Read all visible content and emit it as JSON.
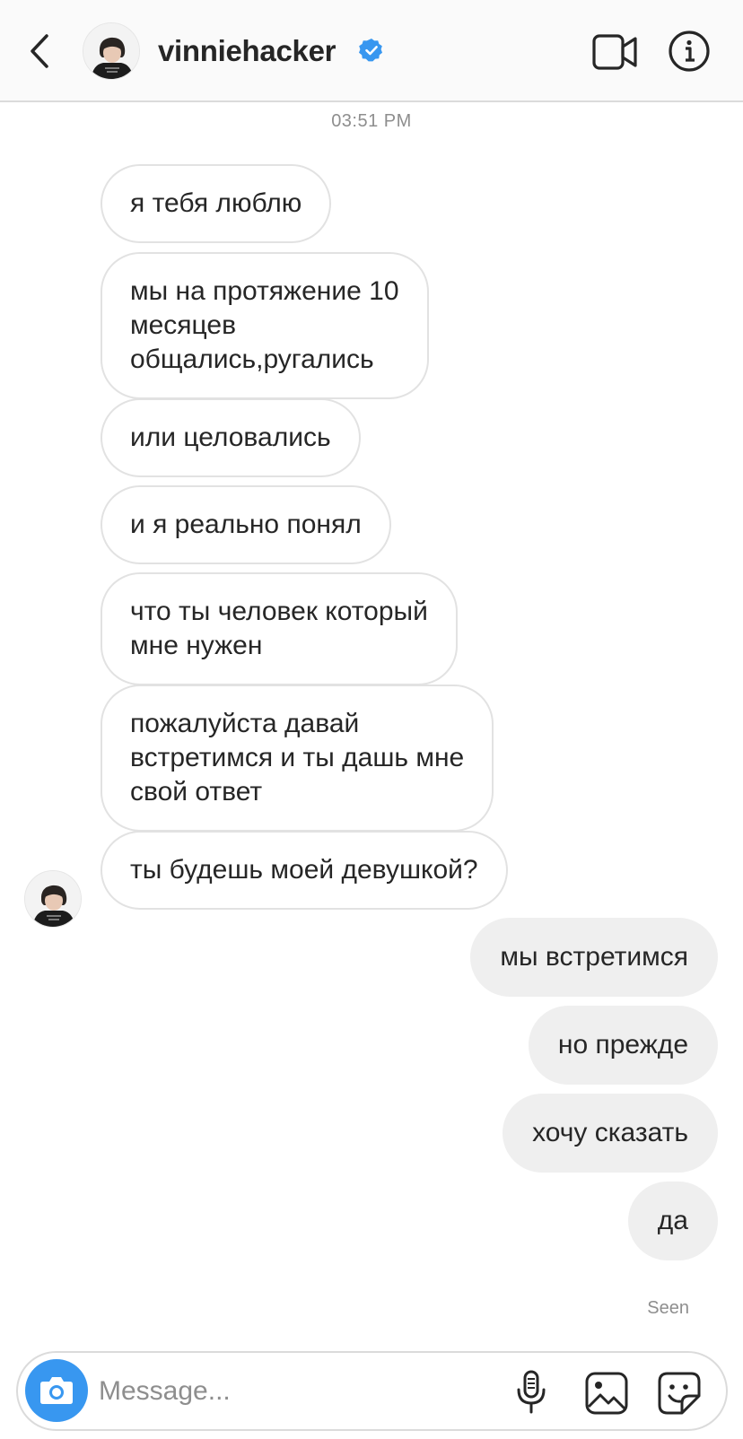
{
  "header": {
    "username": "vinniehacker",
    "icons": [
      "back-icon",
      "verified-badge-icon",
      "video-call-icon",
      "info-icon"
    ]
  },
  "thread": {
    "timestamp": "03:51 PM",
    "incoming": [
      "я тебя люблю",
      "мы на протяжение 10\nмесяцев\nобщались,ругались",
      "или целовались",
      "и я реально понял",
      "что ты человек который\nмне нужен",
      "пожалуйста давай\nвстретимся и ты дашь мне\nсвой ответ",
      "ты будешь моей девушкой?"
    ],
    "outgoing": [
      "мы встретимся",
      "но прежде",
      "хочу сказать",
      "да"
    ],
    "seen_label": "Seen"
  },
  "composer": {
    "placeholder": "Message...",
    "icons": [
      "camera-icon",
      "microphone-icon",
      "gallery-icon",
      "sticker-icon"
    ]
  },
  "colors": {
    "accent": "#3897f0",
    "verified": "#3897f0",
    "outgoing_bubble": "#efefef",
    "incoming_border": "#e2e2e2",
    "text": "#262626",
    "muted": "#8e8e8e"
  }
}
